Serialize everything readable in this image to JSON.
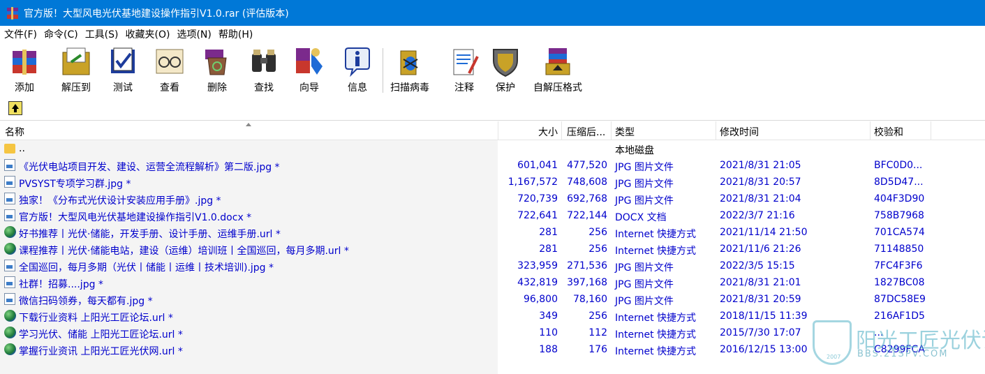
{
  "window": {
    "title": "官方版！大型风电光伏基地建设操作指引V1.0.rar (评估版本)"
  },
  "menu": [
    "文件(F)",
    "命令(C)",
    "工具(S)",
    "收藏夹(O)",
    "选项(N)",
    "帮助(H)"
  ],
  "toolbar": {
    "add": "添加",
    "extract": "解压到",
    "test": "测试",
    "view": "查看",
    "delete": "删除",
    "find": "查找",
    "wizard": "向导",
    "info": "信息",
    "virusscan": "扫描病毒",
    "comment": "注释",
    "protect": "保护",
    "sfx": "自解压格式"
  },
  "columns": {
    "name": "名称",
    "size": "大小",
    "packed": "压缩后...",
    "type": "类型",
    "modified": "修改时间",
    "crc": "校验和"
  },
  "parent_row": {
    "name": "..",
    "type": "本地磁盘"
  },
  "files": [
    {
      "name": "《光伏电站项目开发、建设、运营全流程解析》第二版.jpg *",
      "size": "601,041",
      "packed": "477,520",
      "type": "JPG 图片文件",
      "modified": "2021/8/31 21:05",
      "crc": "BFC0D0...",
      "icon": "image-file-icon"
    },
    {
      "name": "PVSYST专项学习群.jpg *",
      "size": "1,167,572",
      "packed": "748,608",
      "type": "JPG 图片文件",
      "modified": "2021/8/31 20:57",
      "crc": "8D5D47...",
      "icon": "image-file-icon"
    },
    {
      "name": "独家！《分布式光伏设计安装应用手册》.jpg *",
      "size": "720,739",
      "packed": "692,768",
      "type": "JPG 图片文件",
      "modified": "2021/8/31 21:04",
      "crc": "404F3D90",
      "icon": "image-file-icon"
    },
    {
      "name": "官方版！大型风电光伏基地建设操作指引V1.0.docx *",
      "size": "722,641",
      "packed": "722,144",
      "type": "DOCX 文档",
      "modified": "2022/3/7 21:16",
      "crc": "758B7968",
      "icon": "doc-file-icon"
    },
    {
      "name": "好书推荐丨光伏·储能，开发手册、设计手册、运维手册.url *",
      "size": "281",
      "packed": "256",
      "type": "Internet 快捷方式",
      "modified": "2021/11/14 21:50",
      "crc": "701CA574",
      "icon": "globe-icon"
    },
    {
      "name": "课程推荐丨光伏·储能电站，建设（运维）培训班丨全国巡回，每月多期.url *",
      "size": "281",
      "packed": "256",
      "type": "Internet 快捷方式",
      "modified": "2021/11/6 21:26",
      "crc": "71148850",
      "icon": "globe-icon"
    },
    {
      "name": "全国巡回，每月多期（光伏丨储能丨运维丨技术培训).jpg *",
      "size": "323,959",
      "packed": "271,536",
      "type": "JPG 图片文件",
      "modified": "2022/3/5 15:15",
      "crc": "7FC4F3F6",
      "icon": "image-file-icon"
    },
    {
      "name": "社群！招募....jpg *",
      "size": "432,819",
      "packed": "397,168",
      "type": "JPG 图片文件",
      "modified": "2021/8/31 21:01",
      "crc": "1827BC08",
      "icon": "image-file-icon"
    },
    {
      "name": "微信扫码领券，每天都有.jpg *",
      "size": "96,800",
      "packed": "78,160",
      "type": "JPG 图片文件",
      "modified": "2021/8/31 20:59",
      "crc": "87DC58E9",
      "icon": "image-file-icon"
    },
    {
      "name": "下载行业资料 上阳光工匠论坛.url *",
      "size": "349",
      "packed": "256",
      "type": "Internet 快捷方式",
      "modified": "2018/11/15 11:39",
      "crc": "216AF1D5",
      "icon": "globe-icon"
    },
    {
      "name": "学习光伏、储能 上阳光工匠论坛.url *",
      "size": "110",
      "packed": "112",
      "type": "Internet 快捷方式",
      "modified": "2015/7/30 17:07",
      "crc": "...",
      "icon": "globe-icon"
    },
    {
      "name": "掌握行业资讯 上阳光工匠光伏网.url *",
      "size": "188",
      "packed": "176",
      "type": "Internet 快捷方式",
      "modified": "2016/12/15 13:00",
      "crc": "C8299FCA",
      "icon": "globe-icon"
    }
  ],
  "watermark": {
    "text": "阳光工匠光伏论坛",
    "sub": "BBS.21SPV.COM",
    "year": "2007"
  },
  "colors": {
    "titlebar": "#0078d7",
    "file_text": "#0000cc"
  }
}
